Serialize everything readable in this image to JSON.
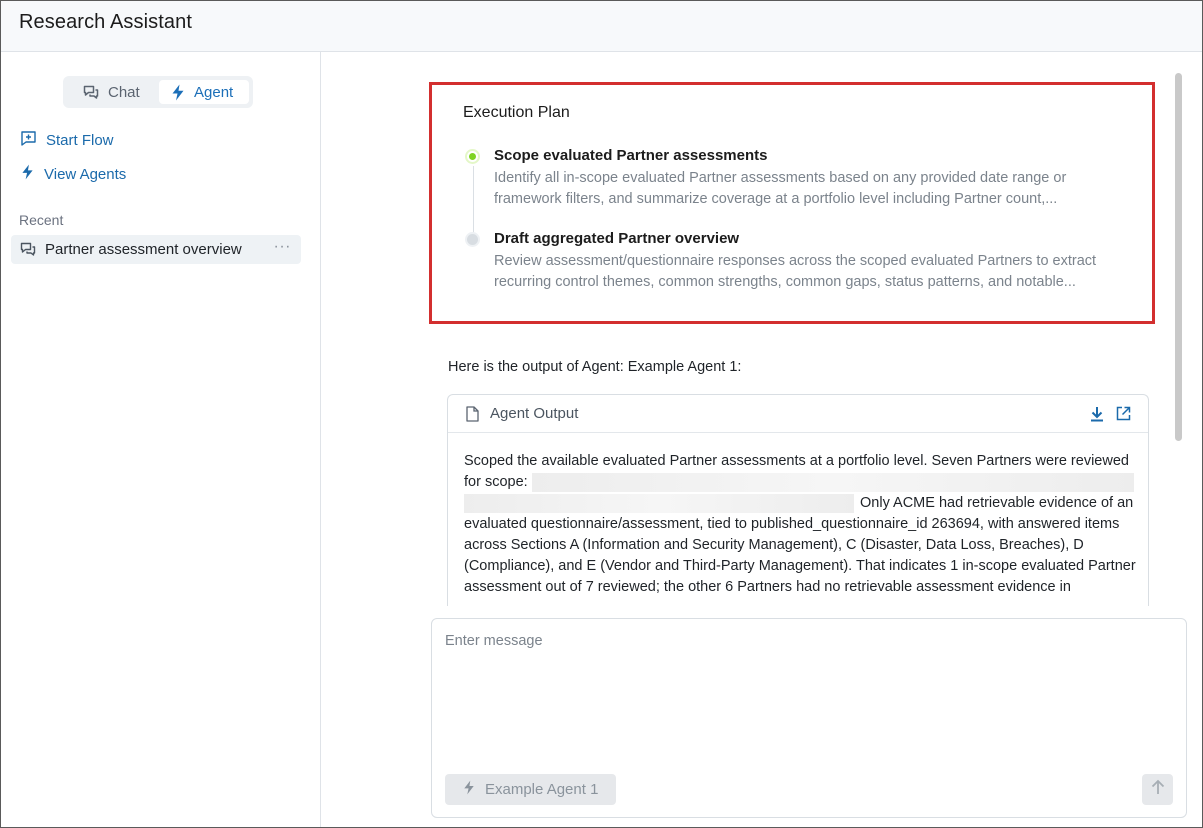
{
  "app": {
    "title": "Research Assistant"
  },
  "sidebar": {
    "mode_toggle": {
      "chat_label": "Chat",
      "agent_label": "Agent",
      "selected": "Agent"
    },
    "links": [
      {
        "label": "Start Flow",
        "icon": "add-chat-icon"
      },
      {
        "label": "View Agents",
        "icon": "lightning-icon"
      }
    ],
    "recent_label": "Recent",
    "recent_items": [
      {
        "label": "Partner assessment overview",
        "icon": "chat-icon",
        "more": "···"
      }
    ]
  },
  "execution_plan": {
    "title": "Execution Plan",
    "steps": [
      {
        "title": "Scope evaluated Partner assessments",
        "description": "Identify all in-scope evaluated Partner assessments based on any provided date range or framework filters, and summarize coverage at a portfolio level including Partner count,...",
        "status": "active"
      },
      {
        "title": "Draft aggregated Partner overview",
        "description": "Review assessment/questionnaire responses across the scoped evaluated Partners to extract recurring control themes, common strengths, common gaps, status patterns, and notable...",
        "status": "pending"
      }
    ]
  },
  "conversation": {
    "intro": "Here is the output of Agent: Example Agent 1:",
    "output_card": {
      "title": "Agent Output",
      "text_part1": "Scoped the available evaluated Partner assessments at a portfolio level. Seven Partners were reviewed for scope:",
      "text_part2": "Only ACME had retrievable evidence of an evaluated questionnaire/assessment, tied to published_questionnaire_id 263694, with answered items across Sections A (Information and Security Management), C (Disaster, Data Loss, Breaches), D (Compliance), and E (Vendor and Third-Party Management). That indicates 1 in-scope evaluated Partner assessment out of 7 reviewed; the other 6 Partners had no retrievable assessment evidence in"
    }
  },
  "composer": {
    "placeholder": "Enter message",
    "agent_chip_label": "Example Agent 1"
  },
  "colors": {
    "accent": "#1b6aab",
    "highlight_border": "#d32f2f",
    "active_step": "#7ed321"
  }
}
